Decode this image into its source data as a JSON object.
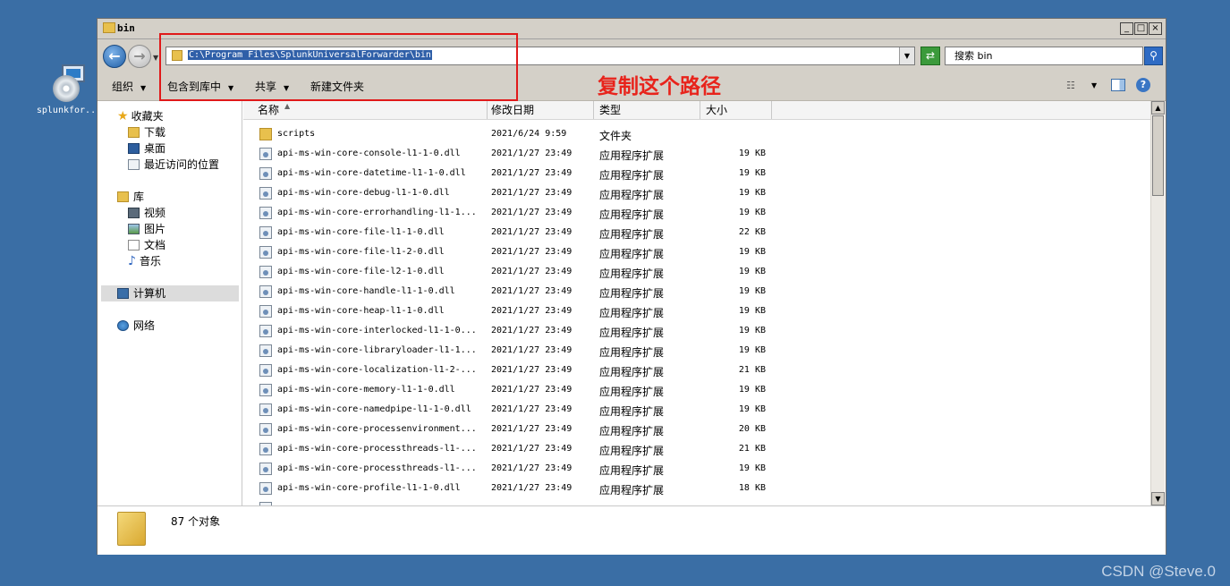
{
  "desktop_icon": {
    "label": "splunkfor..."
  },
  "window": {
    "title": "bin",
    "controls": {
      "minimize": "_",
      "maximize": "□",
      "close": "×"
    }
  },
  "addressbar": {
    "path": "C:\\Program Files\\SplunkUniversalForwarder\\bin",
    "search_placeholder": "搜索 bin"
  },
  "annotation": {
    "text": "复制这个路径",
    "color": "#e8231b"
  },
  "toolbar": {
    "organize": "组织",
    "include_in_library": "包含到库中",
    "share": "共享",
    "new_folder": "新建文件夹"
  },
  "navpane": {
    "favorites": "收藏夹",
    "downloads": "下载",
    "desktop": "桌面",
    "recent": "最近访问的位置",
    "libraries": "库",
    "videos": "视频",
    "pictures": "图片",
    "documents": "文档",
    "music": "音乐",
    "computer": "计算机",
    "network": "网络"
  },
  "columns": {
    "name": "名称",
    "modified": "修改日期",
    "type": "类型",
    "size": "大小"
  },
  "files": [
    {
      "name": "scripts",
      "date": "2021/6/24 9:59",
      "type": "文件夹",
      "size": "",
      "icon": "folder-icon"
    },
    {
      "name": "api-ms-win-core-console-l1-1-0.dll",
      "date": "2021/1/27 23:49",
      "type": "应用程序扩展",
      "size": "19 KB",
      "icon": "dll-icon"
    },
    {
      "name": "api-ms-win-core-datetime-l1-1-0.dll",
      "date": "2021/1/27 23:49",
      "type": "应用程序扩展",
      "size": "19 KB",
      "icon": "dll-icon"
    },
    {
      "name": "api-ms-win-core-debug-l1-1-0.dll",
      "date": "2021/1/27 23:49",
      "type": "应用程序扩展",
      "size": "19 KB",
      "icon": "dll-icon"
    },
    {
      "name": "api-ms-win-core-errorhandling-l1-1...",
      "date": "2021/1/27 23:49",
      "type": "应用程序扩展",
      "size": "19 KB",
      "icon": "dll-icon"
    },
    {
      "name": "api-ms-win-core-file-l1-1-0.dll",
      "date": "2021/1/27 23:49",
      "type": "应用程序扩展",
      "size": "22 KB",
      "icon": "dll-icon"
    },
    {
      "name": "api-ms-win-core-file-l1-2-0.dll",
      "date": "2021/1/27 23:49",
      "type": "应用程序扩展",
      "size": "19 KB",
      "icon": "dll-icon"
    },
    {
      "name": "api-ms-win-core-file-l2-1-0.dll",
      "date": "2021/1/27 23:49",
      "type": "应用程序扩展",
      "size": "19 KB",
      "icon": "dll-icon"
    },
    {
      "name": "api-ms-win-core-handle-l1-1-0.dll",
      "date": "2021/1/27 23:49",
      "type": "应用程序扩展",
      "size": "19 KB",
      "icon": "dll-icon"
    },
    {
      "name": "api-ms-win-core-heap-l1-1-0.dll",
      "date": "2021/1/27 23:49",
      "type": "应用程序扩展",
      "size": "19 KB",
      "icon": "dll-icon"
    },
    {
      "name": "api-ms-win-core-interlocked-l1-1-0...",
      "date": "2021/1/27 23:49",
      "type": "应用程序扩展",
      "size": "19 KB",
      "icon": "dll-icon"
    },
    {
      "name": "api-ms-win-core-libraryloader-l1-1...",
      "date": "2021/1/27 23:49",
      "type": "应用程序扩展",
      "size": "19 KB",
      "icon": "dll-icon"
    },
    {
      "name": "api-ms-win-core-localization-l1-2-...",
      "date": "2021/1/27 23:49",
      "type": "应用程序扩展",
      "size": "21 KB",
      "icon": "dll-icon"
    },
    {
      "name": "api-ms-win-core-memory-l1-1-0.dll",
      "date": "2021/1/27 23:49",
      "type": "应用程序扩展",
      "size": "19 KB",
      "icon": "dll-icon"
    },
    {
      "name": "api-ms-win-core-namedpipe-l1-1-0.dll",
      "date": "2021/1/27 23:49",
      "type": "应用程序扩展",
      "size": "19 KB",
      "icon": "dll-icon"
    },
    {
      "name": "api-ms-win-core-processenvironment...",
      "date": "2021/1/27 23:49",
      "type": "应用程序扩展",
      "size": "20 KB",
      "icon": "dll-icon"
    },
    {
      "name": "api-ms-win-core-processthreads-l1-...",
      "date": "2021/1/27 23:49",
      "type": "应用程序扩展",
      "size": "21 KB",
      "icon": "dll-icon"
    },
    {
      "name": "api-ms-win-core-processthreads-l1-...",
      "date": "2021/1/27 23:49",
      "type": "应用程序扩展",
      "size": "19 KB",
      "icon": "dll-icon"
    },
    {
      "name": "api-ms-win-core-profile-l1-1-0.dll",
      "date": "2021/1/27 23:49",
      "type": "应用程序扩展",
      "size": "18 KB",
      "icon": "dll-icon"
    }
  ],
  "statusbar": {
    "count": "87 个对象"
  },
  "watermark": "CSDN @Steve.0"
}
